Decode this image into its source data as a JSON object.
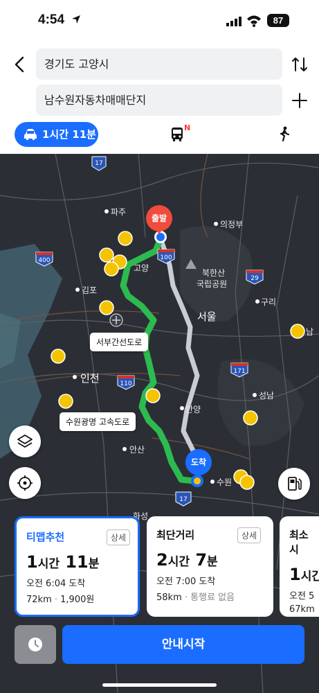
{
  "status": {
    "time": "4:54",
    "battery": "87"
  },
  "search": {
    "origin": "경기도 고양시",
    "destination": "남수원자동차매매단지"
  },
  "modes": {
    "car_label": "1시간 11분",
    "bus_badge": "N"
  },
  "map": {
    "labels": {
      "paju": "파주",
      "uijeongbu": "의정부",
      "goyang": "고양",
      "gimpo": "김포",
      "bukhansan": "북한산",
      "national_park": "국립공원",
      "seoul": "서울",
      "guri": "구리",
      "incheon": "인천",
      "seongnam": "성남",
      "anyang": "안양",
      "ansan": "안산",
      "suwon": "수원",
      "hwaseong": "화성",
      "i": "남"
    },
    "roads": {
      "seobu": "서부간선도로",
      "suwon_gwangmyeong": "수원광명 고속도로"
    },
    "shields": {
      "r17": "17",
      "r100": "100",
      "r400": "400",
      "r29": "29",
      "r110": "110",
      "r171": "171",
      "r17b": "17"
    },
    "pins": {
      "start": "출발",
      "end": "도착"
    }
  },
  "routes": [
    {
      "title": "티맵추천",
      "detail": "상세",
      "hours": "1",
      "hours_unit": "시간",
      "minutes": "11",
      "minutes_unit": "분",
      "arrival": "오전 6:04 도착",
      "distance": "72km",
      "toll": "1,900원"
    },
    {
      "title": "최단거리",
      "detail": "상세",
      "hours": "2",
      "hours_unit": "시간",
      "minutes": "7",
      "minutes_unit": "분",
      "arrival": "오전 7:00 도착",
      "distance": "58km",
      "toll": "통행료 없음"
    },
    {
      "title": "최소시",
      "hours": "1",
      "hours_unit": "시간",
      "arrival": "오전 5",
      "distance": "67km"
    }
  ],
  "actions": {
    "start_label": "안내시작"
  },
  "colors": {
    "accent": "#1a6dff",
    "route": "#2dbb4f",
    "start_pin": "#f04b3c"
  }
}
